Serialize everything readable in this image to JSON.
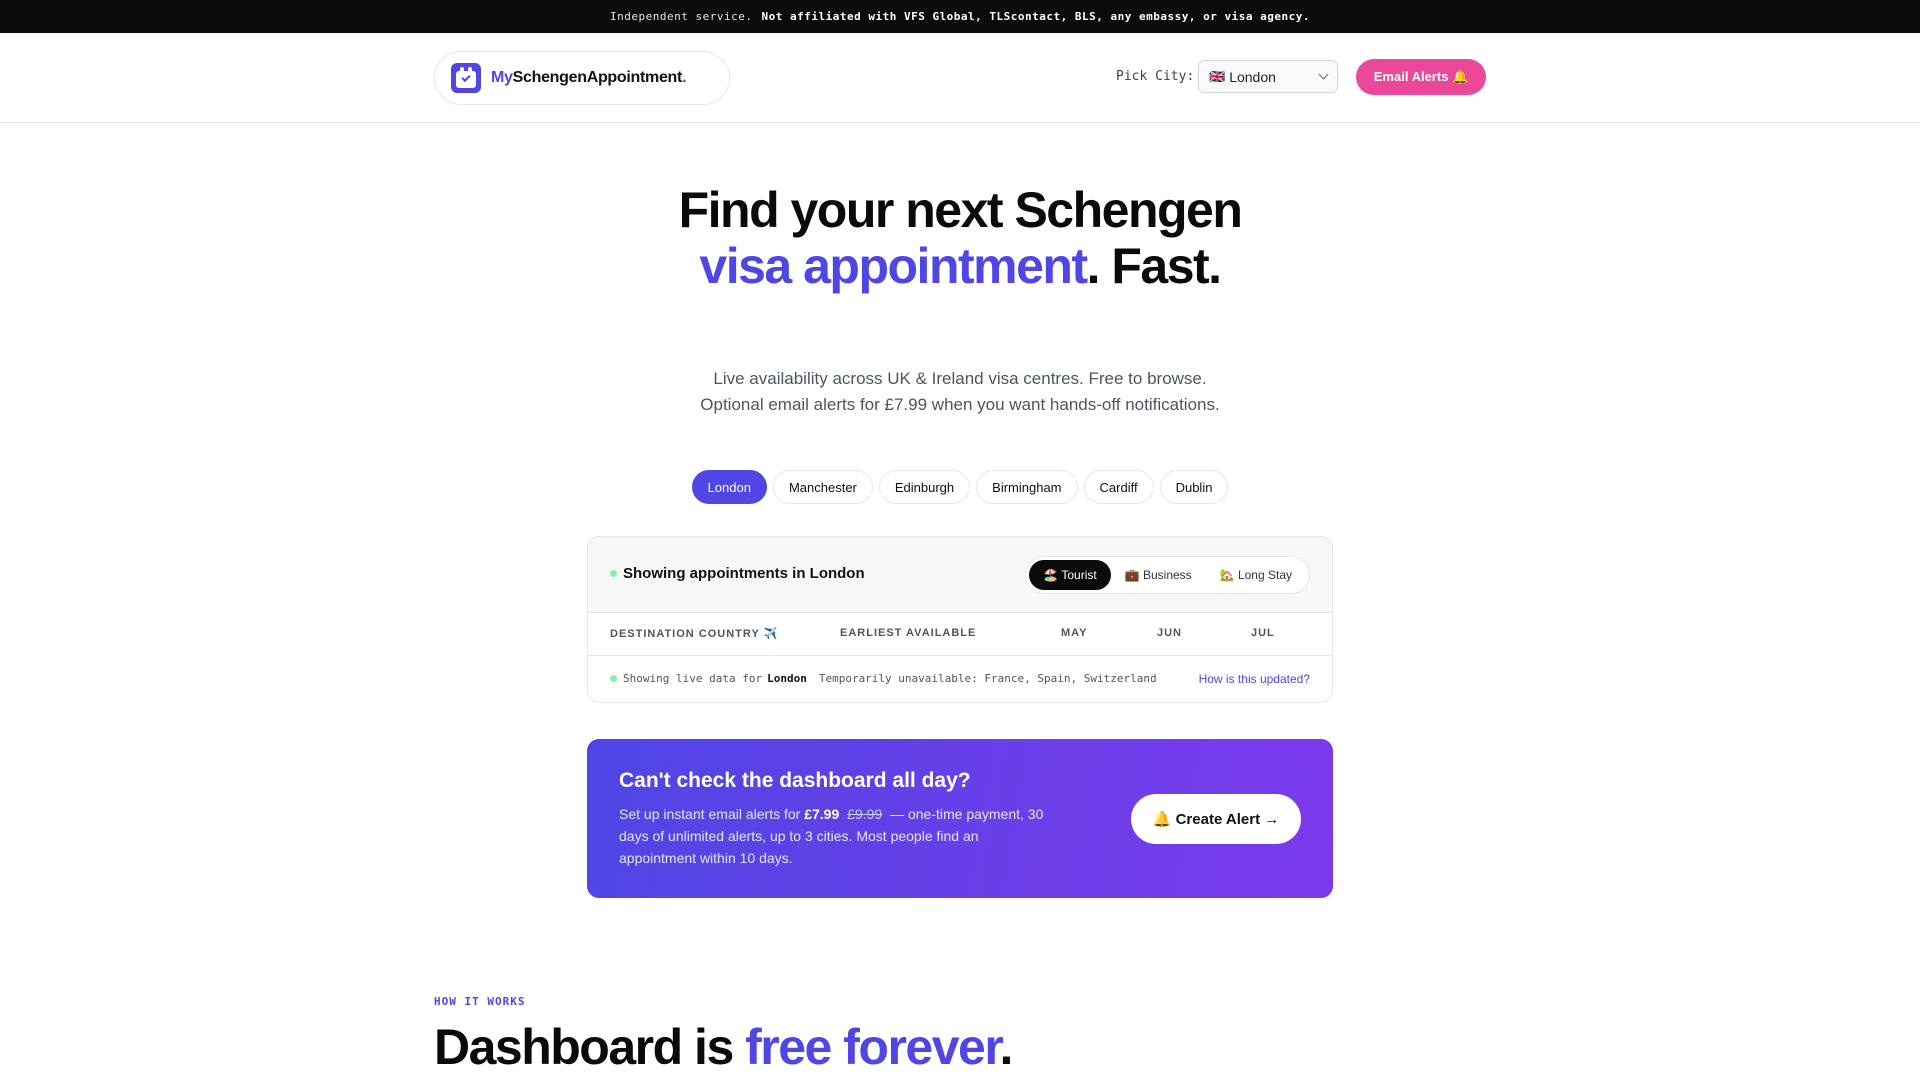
{
  "banner": {
    "lead": "Independent service.",
    "disclaimer": "Not affiliated with VFS Global, TLScontact, BLS, any embassy, or visa agency."
  },
  "header": {
    "logo_my": "My",
    "logo_main": "SchengenAppointment",
    "logo_dot": ".",
    "pick_city_label": "Pick City:",
    "city_flag": "🇬🇧",
    "city_selected": "London",
    "alerts_button": "Email Alerts 🔔"
  },
  "hero": {
    "title_1": "Find your next Schengen ",
    "title_accent": "visa appointment",
    "title_2": ". Fast.",
    "subtitle": "Live availability across UK & Ireland visa centres. Free to browse. Optional email alerts for £7.99 when you want hands-off notifications."
  },
  "cities": [
    "London",
    "Manchester",
    "Edinburgh",
    "Birmingham",
    "Cardiff",
    "Dublin"
  ],
  "active_city_index": 0,
  "dashboard": {
    "status": "Showing appointments in London",
    "visa_types": [
      {
        "label": "🏖️ Tourist",
        "active": true
      },
      {
        "label": "💼 Business",
        "active": false
      },
      {
        "label": "🏡 Long Stay",
        "active": false
      }
    ],
    "columns": [
      "DESTINATION COUNTRY ✈️",
      "EARLIEST AVAILABLE",
      "MAY",
      "JUN",
      "JUL"
    ],
    "footer_live": "Showing live data for",
    "footer_city": "London",
    "footer_unavailable": "Temporarily unavailable: France, Spain, Switzerland",
    "footer_link": "How is this updated?"
  },
  "cta": {
    "title": "Can't check the dashboard all day?",
    "text_1": "Set up instant email alerts for",
    "price": "£7.99",
    "old_price": "£9.99",
    "text_2": "— one-time payment, 30 days of unlimited alerts, up to 3 cities. Most people find an appointment within 10 days.",
    "button": "🔔 Create Alert →"
  },
  "how": {
    "label": "HOW IT WORKS",
    "title_1": "Dashboard is ",
    "title_accent": "free forever",
    "title_2": "."
  }
}
